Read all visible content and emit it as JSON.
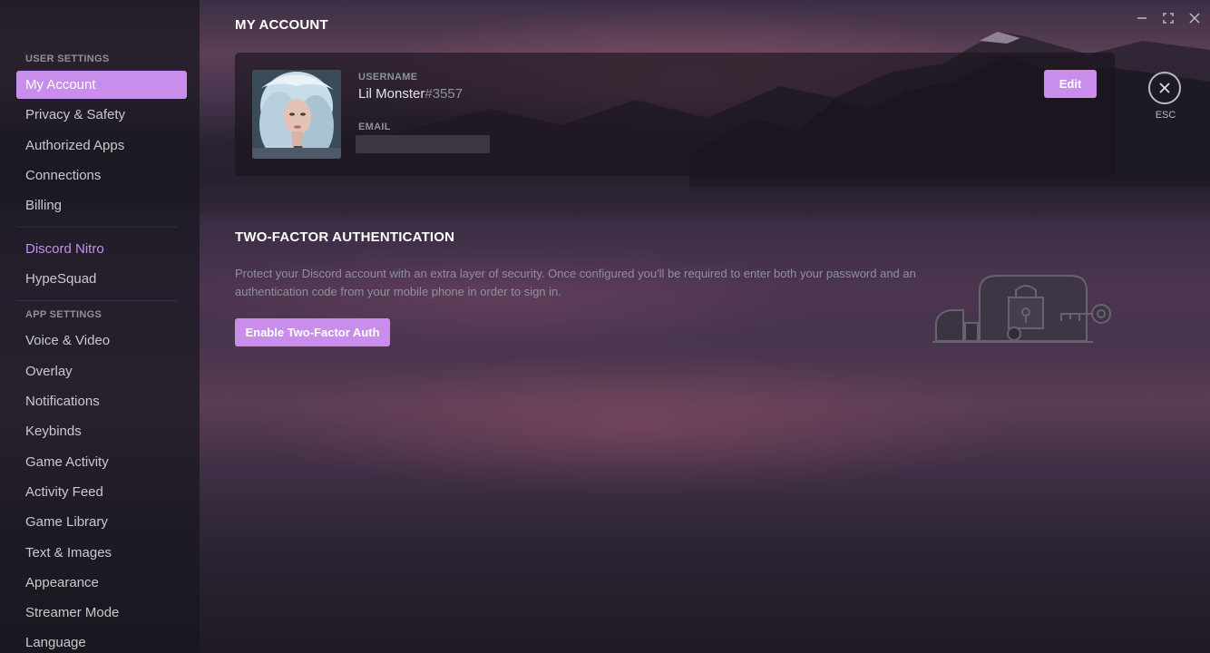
{
  "window": {
    "controls": [
      {
        "icon": "minimize-icon"
      },
      {
        "icon": "maximize-icon"
      },
      {
        "icon": "close-window-icon"
      }
    ]
  },
  "sidebar": {
    "user_settings_header": "USER SETTINGS",
    "user_items": [
      {
        "label": "My Account",
        "active": true
      },
      {
        "label": "Privacy & Safety"
      },
      {
        "label": "Authorized Apps"
      },
      {
        "label": "Connections"
      },
      {
        "label": "Billing"
      }
    ],
    "nitro_items": [
      {
        "label": "Discord Nitro"
      },
      {
        "label": "HypeSquad"
      }
    ],
    "app_settings_header": "APP SETTINGS",
    "app_items": [
      {
        "label": "Voice & Video"
      },
      {
        "label": "Overlay"
      },
      {
        "label": "Notifications"
      },
      {
        "label": "Keybinds"
      },
      {
        "label": "Game Activity"
      },
      {
        "label": "Activity Feed"
      },
      {
        "label": "Game Library"
      },
      {
        "label": "Text & Images"
      },
      {
        "label": "Appearance"
      },
      {
        "label": "Streamer Mode"
      },
      {
        "label": "Language"
      }
    ]
  },
  "main": {
    "title": "MY ACCOUNT",
    "account": {
      "username_label": "USERNAME",
      "username": "Lil Monster",
      "discriminator": "#3557",
      "email_label": "EMAIL",
      "edit_label": "Edit"
    },
    "close": {
      "icon": "close-icon",
      "label": "ESC"
    },
    "two_factor": {
      "title": "TWO-FACTOR AUTHENTICATION",
      "description": "Protect your Discord account with an extra layer of security. Once configured you'll be required to enter both your password and an authentication code from your mobile phone in order to sign in.",
      "button_label": "Enable Two-Factor Auth",
      "illustration": "lock-key-illustration-icon"
    }
  },
  "colors": {
    "accent": "#c98eec",
    "nitro": "#c58ff0",
    "muted_text": "#8e9297"
  }
}
